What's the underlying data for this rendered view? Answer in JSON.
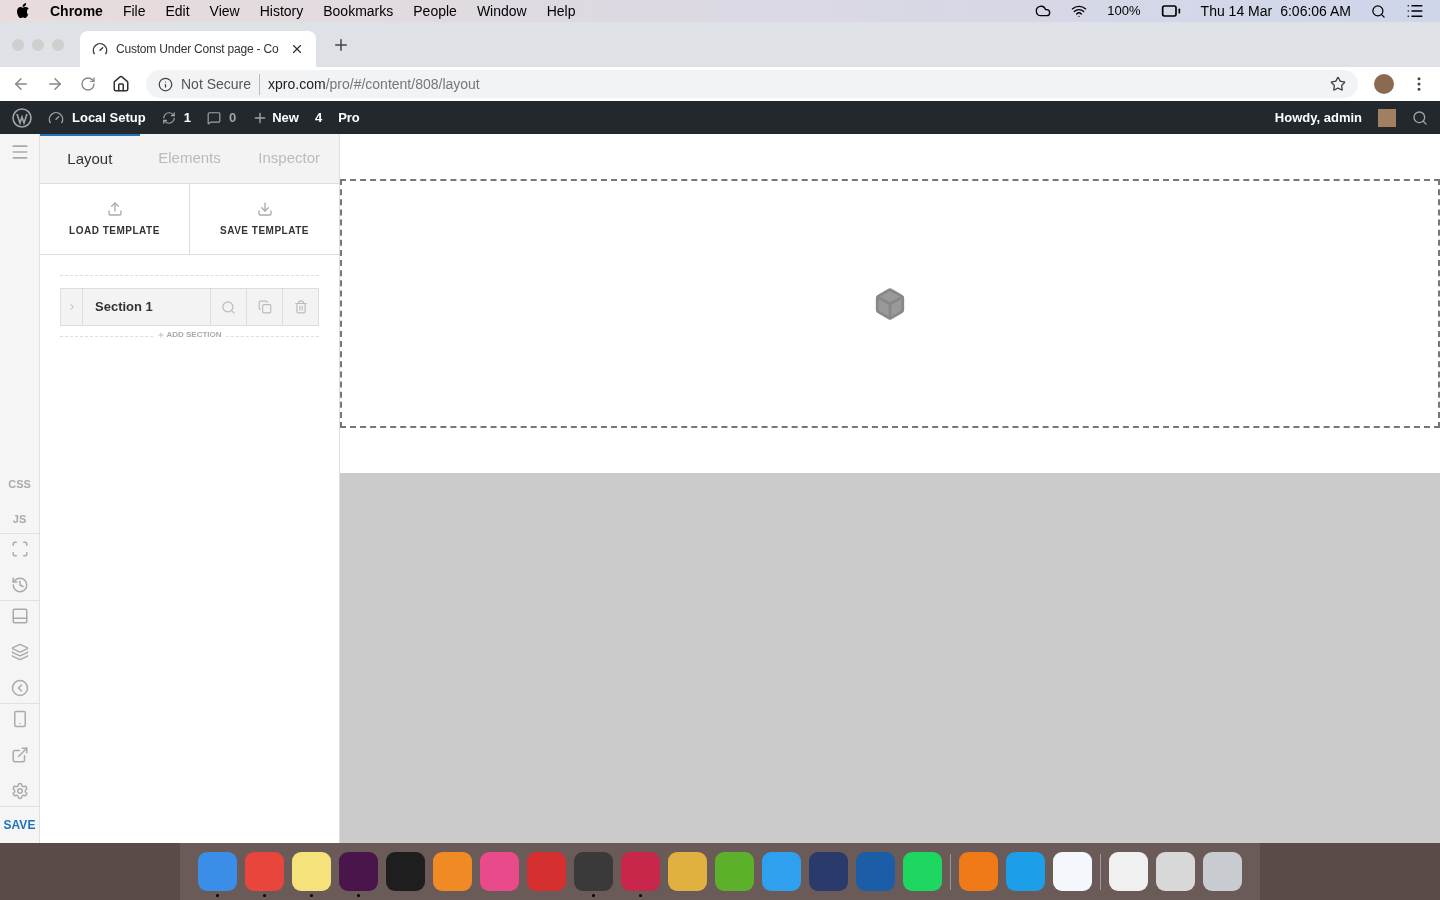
{
  "menubar": {
    "app": "Chrome",
    "menus": [
      "File",
      "Edit",
      "View",
      "History",
      "Bookmarks",
      "People",
      "Window",
      "Help"
    ],
    "battery": "100%",
    "date": "Thu 14 Mar",
    "time": "6:06:06 AM"
  },
  "browser": {
    "tab": {
      "title": "Custom Under Const page - Co"
    },
    "address": {
      "security": "Not Secure",
      "host": "xpro.com",
      "path": "/pro/#/content/808/layout"
    }
  },
  "wp_bar": {
    "site": "Local Setup",
    "updates": "1",
    "comments": "0",
    "new": "New",
    "count": "4",
    "pro": "Pro",
    "greeting": "Howdy, admin"
  },
  "rail": {
    "groups": [
      [
        {
          "kind": "text",
          "label": "CSS"
        },
        {
          "kind": "text",
          "label": "JS"
        }
      ],
      [
        {
          "kind": "resize"
        },
        {
          "kind": "history"
        }
      ],
      [
        {
          "kind": "header"
        },
        {
          "kind": "layers"
        },
        {
          "kind": "back"
        }
      ],
      [
        {
          "kind": "mobile"
        },
        {
          "kind": "external"
        },
        {
          "kind": "settings"
        }
      ]
    ],
    "save": "SAVE"
  },
  "panel": {
    "tabs": [
      {
        "label": "Layout",
        "selected": true
      },
      {
        "label": "Elements",
        "selected": false
      },
      {
        "label": "Inspector",
        "selected": false
      }
    ],
    "templates": [
      {
        "kind": "upload",
        "label": "LOAD TEMPLATE"
      },
      {
        "kind": "download",
        "label": "SAVE TEMPLATE"
      }
    ],
    "sections": [
      {
        "label": "Section 1",
        "expanded": false
      }
    ],
    "add_section": "ADD SECTION"
  },
  "dock": {
    "groups": [
      [
        {
          "color": "#3b8ee8",
          "running": true
        },
        {
          "color": "#e8453c",
          "running": true
        },
        {
          "color": "#f5e27a",
          "running": true
        },
        {
          "color": "#4a154b",
          "running": true
        },
        {
          "color": "#1e1e1e",
          "running": false
        },
        {
          "color": "#f08a24",
          "running": false
        },
        {
          "color": "#e84a8a",
          "running": false
        },
        {
          "color": "#d62f2f",
          "running": false
        },
        {
          "color": "#3a3a3a",
          "running": true
        },
        {
          "color": "#c8264a",
          "running": true
        },
        {
          "color": "#e0b040",
          "running": false
        },
        {
          "color": "#5cb02a",
          "running": false
        },
        {
          "color": "#2ea0ee",
          "running": false
        },
        {
          "color": "#2a3a6a",
          "running": false
        },
        {
          "color": "#1c5da8",
          "running": false
        },
        {
          "color": "#1ed760",
          "running": false
        }
      ],
      [
        {
          "color": "#f07a18",
          "running": false
        },
        {
          "color": "#1d9ee8",
          "running": false
        },
        {
          "color": "#f4f8fc",
          "running": false
        }
      ],
      [
        {
          "color": "#f0f0f0",
          "running": false
        },
        {
          "color": "#d8d8d8",
          "running": false
        },
        {
          "color": "#c8ccd0",
          "running": false
        }
      ]
    ]
  }
}
